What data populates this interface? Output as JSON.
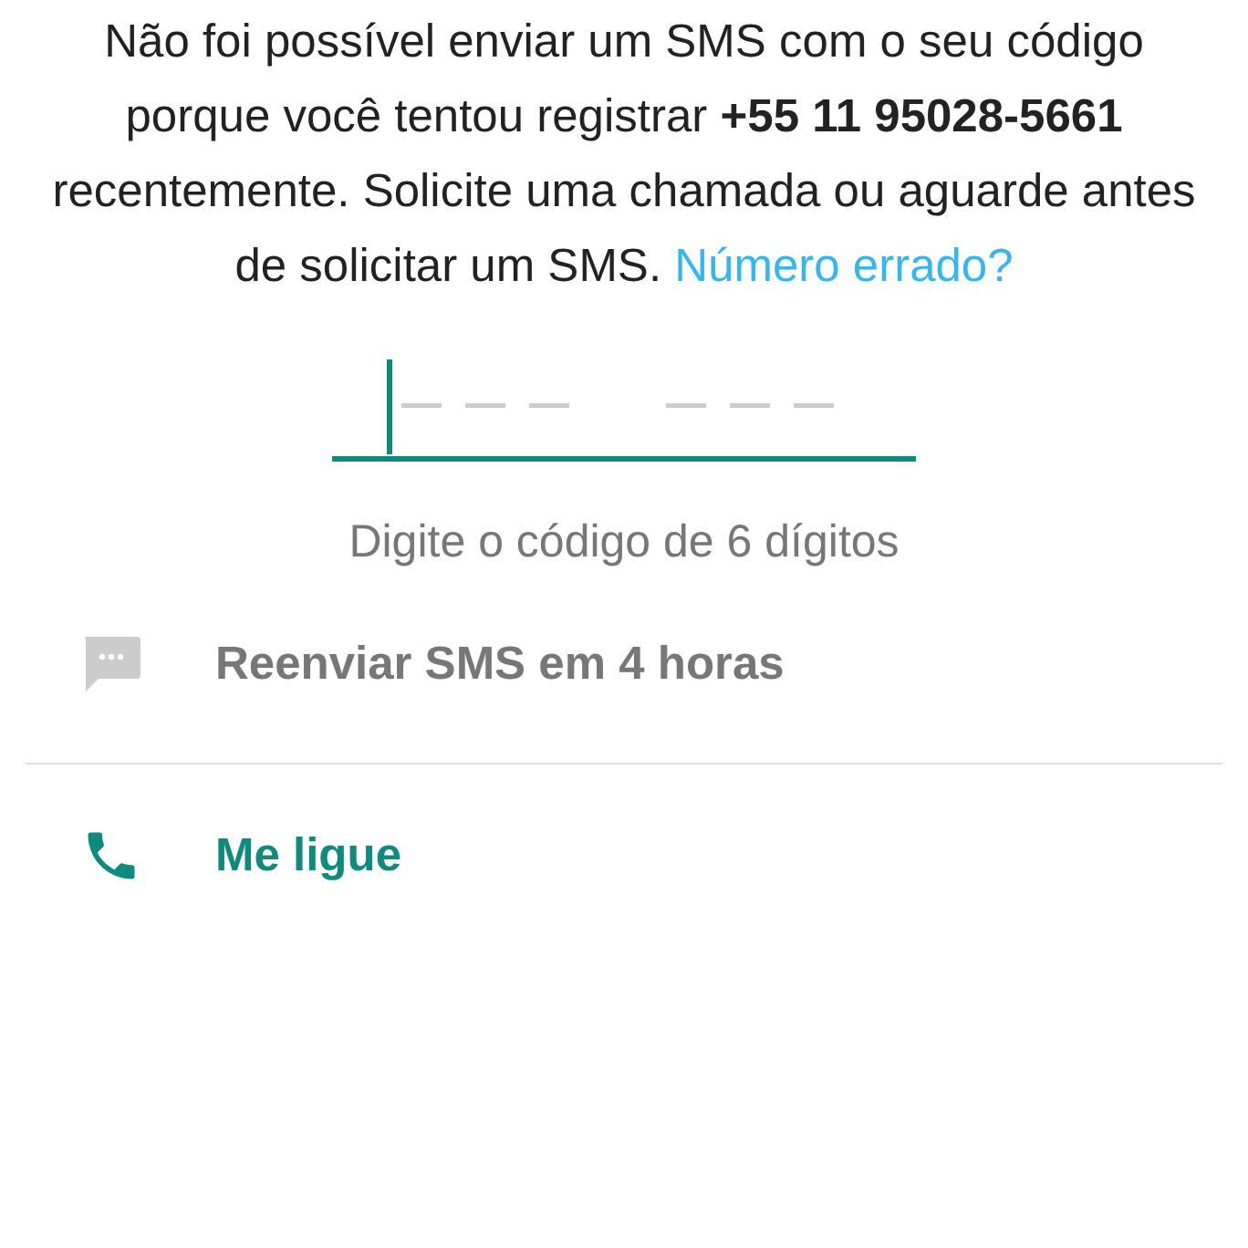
{
  "message": {
    "text": "Não foi possível enviar um SMS com o seu código porque você tentou registrar **+55 11 95028-5661** recentemente. Solicite uma chamada ou aguarde antes de solicitar um SMS.",
    "link": "Número errado?"
  },
  "code_field": {
    "focused": true
  },
  "hint": "Digite o código de 6 dígitos",
  "options": [
    {
      "kind": "sms",
      "label": "Reenviar SMS em 4 horas",
      "disabled": true
    },
    {
      "kind": "call",
      "label": "Me ligue",
      "disabled": false
    }
  ]
}
